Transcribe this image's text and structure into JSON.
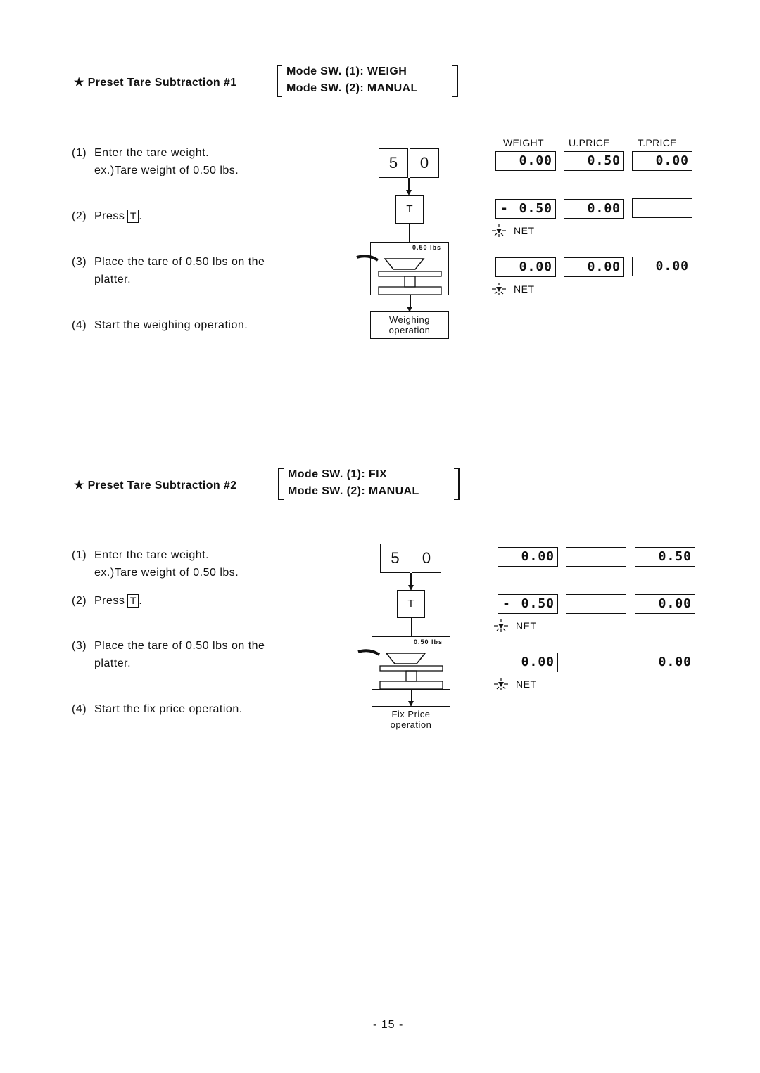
{
  "sections": [
    {
      "title": "★ Preset Tare Subtraction #1",
      "mode_lines": [
        "Mode SW. (1): WEIGH",
        "Mode SW. (2): MANUAL"
      ],
      "steps": [
        {
          "num": "(1)",
          "text": "Enter the tare weight.",
          "sub": "ex.)Tare weight of 0.50 lbs."
        },
        {
          "num": "(2)",
          "text": "Press",
          "key": "T",
          "suffix": "."
        },
        {
          "num": "(3)",
          "text": "Place the tare of 0.50 lbs on the",
          "sub": "platter."
        },
        {
          "num": "(4)",
          "text": "Start the weighing operation."
        }
      ],
      "flow": {
        "keys": [
          "5",
          "0"
        ],
        "tare_key": "T",
        "scale_reading": "0.50 lbs",
        "result_lines": [
          "Weighing",
          "operation"
        ]
      },
      "display_headers": [
        "WEIGHT",
        "U.PRICE",
        "T.PRICE"
      ],
      "display_rows": [
        {
          "weight": "0.00",
          "weight_minus": "",
          "uprice": "0.50",
          "tprice": "0.00",
          "net": ""
        },
        {
          "weight": "0.50",
          "weight_minus": "-",
          "uprice": "0.00",
          "tprice": "",
          "net": "NET"
        },
        {
          "weight": "0.00",
          "weight_minus": "",
          "uprice": "0.00",
          "tprice": "0.00",
          "net": "NET"
        }
      ]
    },
    {
      "title": "★ Preset Tare Subtraction #2",
      "mode_lines": [
        "Mode SW. (1): FIX",
        "Mode SW. (2): MANUAL"
      ],
      "steps": [
        {
          "num": "(1)",
          "text": "Enter the tare weight.",
          "sub": "ex.)Tare weight of 0.50 lbs."
        },
        {
          "num": "(2)",
          "text": "Press",
          "key": "T",
          "suffix": "."
        },
        {
          "num": "(3)",
          "text": "Place the tare of 0.50 lbs on the",
          "sub": "platter."
        },
        {
          "num": "(4)",
          "text": "Start the fix price operation."
        }
      ],
      "flow": {
        "keys": [
          "5",
          "0"
        ],
        "tare_key": "T",
        "scale_reading": "0.50 lbs",
        "result_lines": [
          "Fix Price",
          "operation"
        ]
      },
      "display_rows": [
        {
          "weight": "0.00",
          "weight_minus": "",
          "uprice": "",
          "tprice": "0.50",
          "net": ""
        },
        {
          "weight": "0.50",
          "weight_minus": "-",
          "uprice": "",
          "tprice": "0.00",
          "net": "NET"
        },
        {
          "weight": "0.00",
          "weight_minus": "",
          "uprice": "",
          "tprice": "0.00",
          "net": "NET"
        }
      ]
    }
  ],
  "page_number": "- 15 -"
}
